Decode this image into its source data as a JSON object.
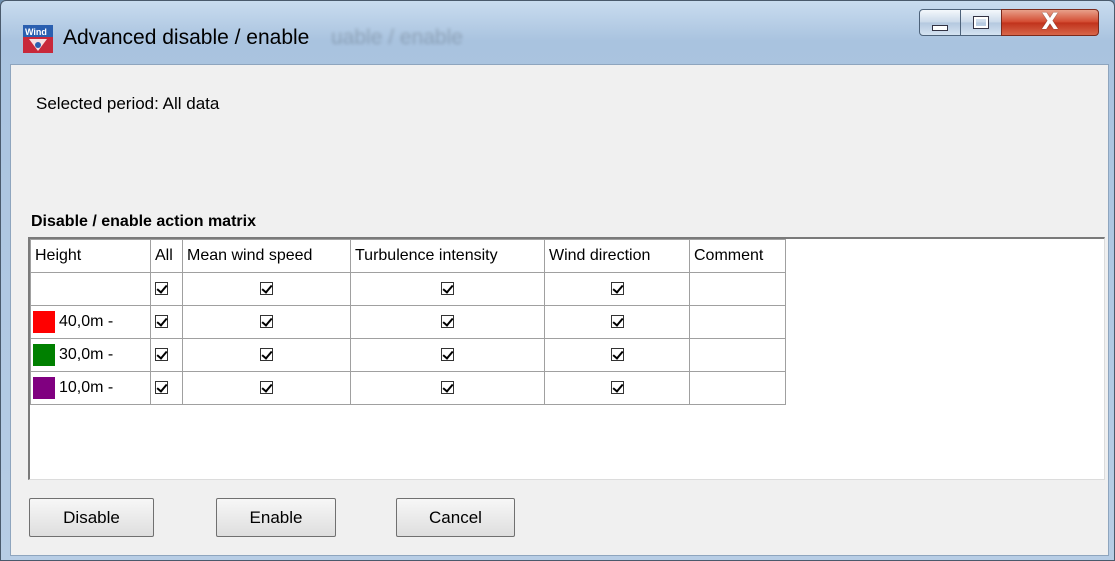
{
  "window": {
    "title": "Advanced disable / enable",
    "title_ghost": "uable / enable",
    "controls": {
      "minimize": "minimize",
      "maximize": "maximize",
      "close": "X"
    }
  },
  "period_text": "Selected period: All data",
  "matrix": {
    "title": "Disable / enable action matrix",
    "columns": [
      "Height",
      "All",
      "Mean wind speed",
      "Turbulence intensity",
      "Wind direction",
      "Comment"
    ],
    "rows": [
      {
        "height": "",
        "swatch": null,
        "all": true,
        "mean_wind_speed": true,
        "turbulence_intensity": true,
        "wind_direction": true,
        "comment": ""
      },
      {
        "height": "40,0m -",
        "swatch": "#ff0000",
        "all": true,
        "mean_wind_speed": true,
        "turbulence_intensity": true,
        "wind_direction": true,
        "comment": ""
      },
      {
        "height": "30,0m -",
        "swatch": "#008000",
        "all": true,
        "mean_wind_speed": true,
        "turbulence_intensity": true,
        "wind_direction": true,
        "comment": ""
      },
      {
        "height": "10,0m -",
        "swatch": "#800080",
        "all": true,
        "mean_wind_speed": true,
        "turbulence_intensity": true,
        "wind_direction": true,
        "comment": ""
      }
    ]
  },
  "buttons": {
    "disable": "Disable",
    "enable": "Enable",
    "cancel": "Cancel"
  },
  "icons": {
    "app": "windographer-icon",
    "check": "checkmark-icon"
  }
}
